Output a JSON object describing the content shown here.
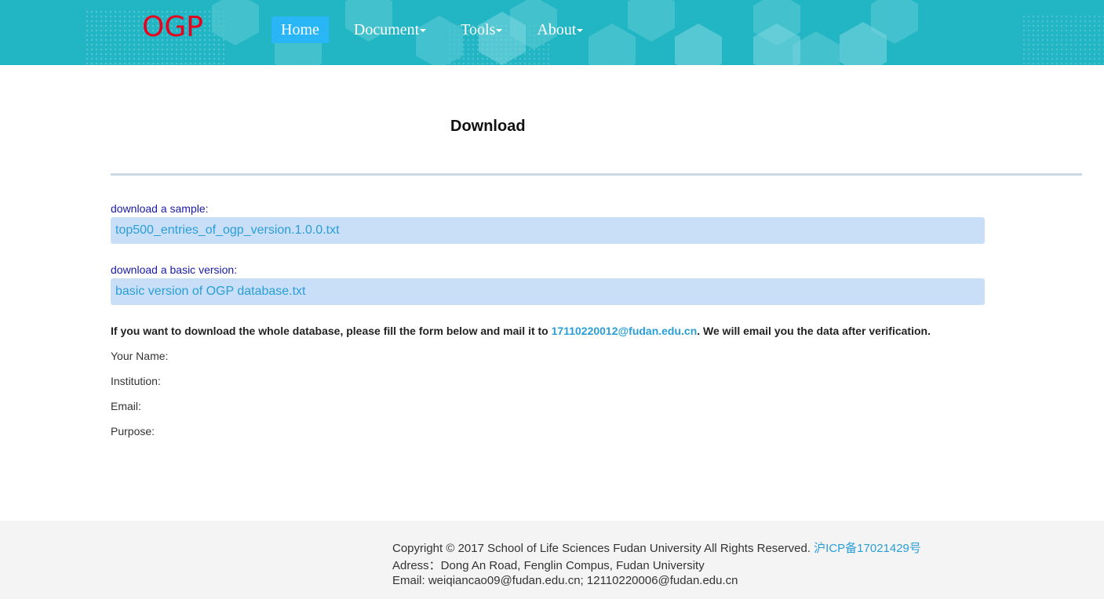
{
  "header": {
    "logo": "OGP",
    "nav": [
      {
        "label": "Home",
        "active": true,
        "dropdown": false
      },
      {
        "label": "Document",
        "active": false,
        "dropdown": true
      },
      {
        "label": "Tools",
        "active": false,
        "dropdown": true
      },
      {
        "label": "About",
        "active": false,
        "dropdown": true
      }
    ]
  },
  "main": {
    "title": "Download",
    "sample": {
      "label": "download a sample:",
      "file": "top500_entries_of_ogp_version.1.0.0.txt"
    },
    "basic": {
      "label": "download a basic version:",
      "file": "basic version of OGP database.txt"
    },
    "info": {
      "before": "If you want to download the whole database, please fill the form below and mail it to ",
      "email": "17110220012@fudan.edu.cn",
      "after": ". We will email you the data after verification."
    },
    "form_fields": [
      "Your Name:",
      "Institution:",
      "Email:",
      "Purpose:"
    ]
  },
  "footer": {
    "copyright": "Copyright © 2017 School of Life Sciences Fudan University All Rights Reserved. ",
    "icp": "沪ICP备17021429号",
    "address": "Adress：Dong An Road, Fenglin Compus, Fudan University",
    "email": "Email: weiqiancao09@fudan.edu.cn; 12110220006@fudan.edu.cn"
  },
  "colors": {
    "header_bg": "#22b5c3",
    "logo": "#e8001c",
    "active_nav": "#29b6f6",
    "link": "#2a9ed8",
    "download_box": "#c9dff7",
    "label_blue": "#1a1aa6",
    "footer_bg": "#f4f4f4"
  }
}
